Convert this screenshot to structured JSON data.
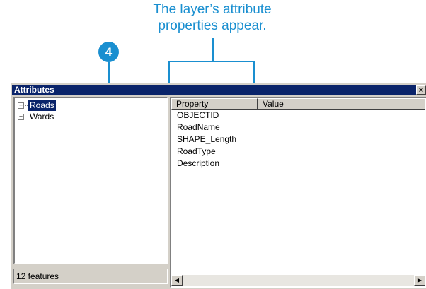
{
  "callout": {
    "line1": "The layer’s attribute",
    "line2": "properties appear."
  },
  "step_badge": "4",
  "window": {
    "title": "Attributes",
    "close_label": "×"
  },
  "tree": {
    "items": [
      {
        "expander": "+",
        "label": "Roads",
        "selected": true
      },
      {
        "expander": "+",
        "label": "Wards",
        "selected": false
      }
    ]
  },
  "status": {
    "text": "12 features"
  },
  "properties": {
    "columns": [
      "Property",
      "Value"
    ],
    "rows": [
      "OBJECTID",
      "RoadName",
      "SHAPE_Length",
      "RoadType",
      "Description"
    ]
  },
  "scrollbar": {
    "left_arrow": "◀",
    "right_arrow": "▶"
  },
  "colors": {
    "accent": "#1a8fd0",
    "titlebar": "#0a246a",
    "selection": "#0a246a"
  }
}
